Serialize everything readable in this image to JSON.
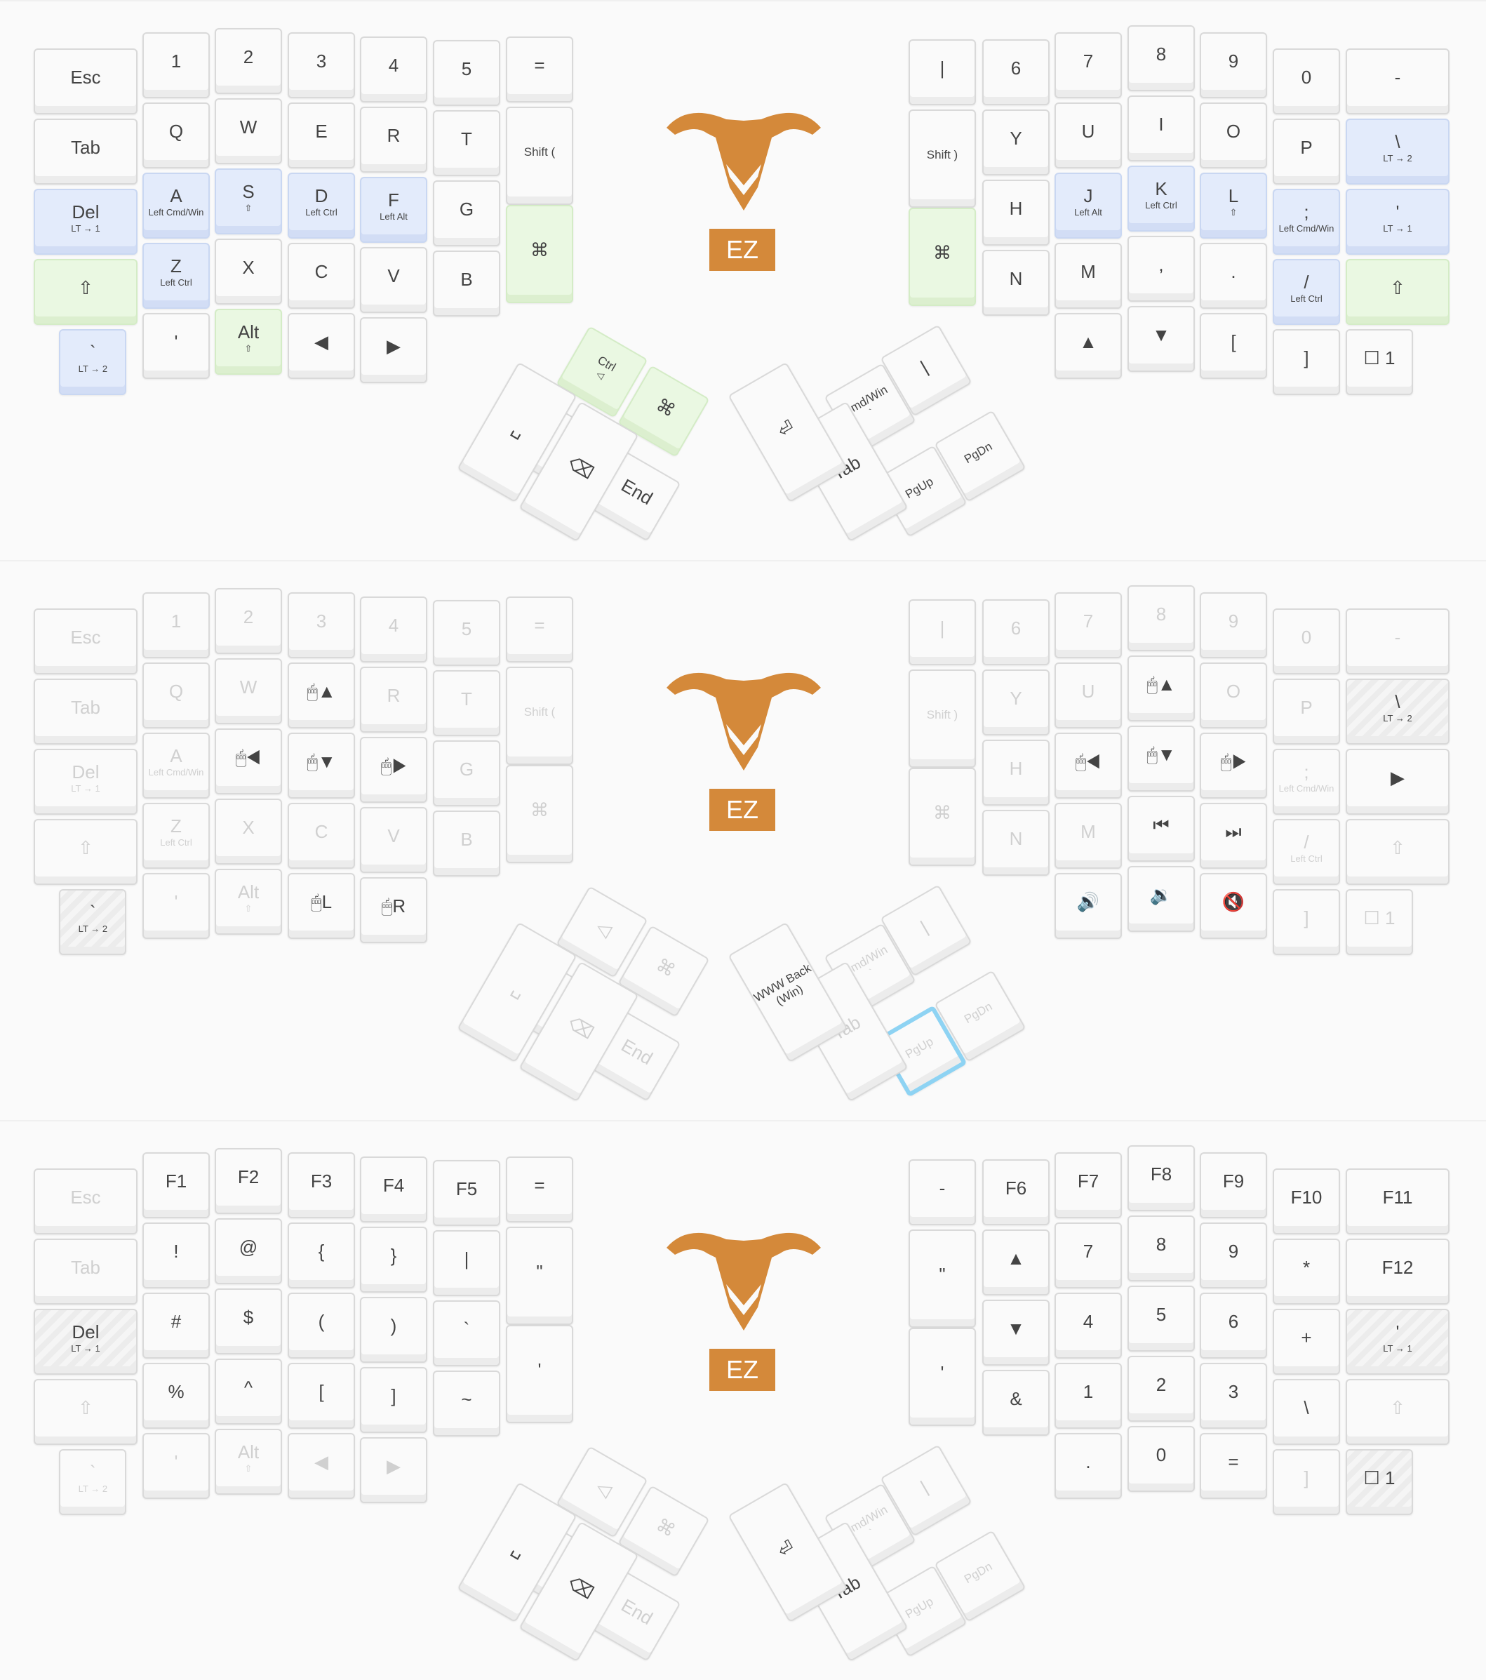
{
  "brand": {
    "logo_text": "EZ",
    "accent": "#d4893a"
  },
  "colors": {
    "modifier_blue": "#e3ebfb",
    "modifier_green": "#eaf8e2",
    "selection": "#8ed3f3"
  },
  "layers": [
    {
      "name": "layer-0",
      "dim": false,
      "left": [
        [
          {
            "m": "Esc"
          },
          {
            "m": "1"
          },
          {
            "m": "2"
          },
          {
            "m": "3"
          },
          {
            "m": "4"
          },
          {
            "m": "5"
          },
          {
            "m": "="
          }
        ],
        [
          {
            "m": "Tab"
          },
          {
            "m": "Q"
          },
          {
            "m": "W"
          },
          {
            "m": "E"
          },
          {
            "m": "R"
          },
          {
            "m": "T"
          },
          {
            "m": "Shift ("
          }
        ],
        [
          {
            "m": "Del",
            "s": "LT → 1",
            "c": "blue"
          },
          {
            "m": "A",
            "s": "Left Cmd/Win",
            "c": "blue"
          },
          {
            "m": "S",
            "s": "⇧",
            "c": "blue"
          },
          {
            "m": "D",
            "s": "Left Ctrl",
            "c": "blue"
          },
          {
            "m": "F",
            "s": "Left Alt",
            "c": "blue"
          },
          {
            "m": "G"
          },
          {
            "m": "⌘",
            "c": "green"
          }
        ],
        [
          {
            "m": "⇧",
            "c": "green"
          },
          {
            "m": "Z",
            "s": "Left Ctrl",
            "c": "blue"
          },
          {
            "m": "X"
          },
          {
            "m": "C"
          },
          {
            "m": "V"
          },
          {
            "m": "B"
          }
        ],
        [
          {
            "m": "`",
            "s": "LT → 2",
            "c": "blue"
          },
          {
            "m": "'"
          },
          {
            "m": "Alt",
            "s": "⇧",
            "c": "green"
          },
          {
            "m": "◀"
          },
          {
            "m": "▶"
          }
        ]
      ],
      "right": [
        [
          {
            "m": "|"
          },
          {
            "m": "6"
          },
          {
            "m": "7"
          },
          {
            "m": "8"
          },
          {
            "m": "9"
          },
          {
            "m": "0"
          },
          {
            "m": "-"
          }
        ],
        [
          {
            "m": "Shift )"
          },
          {
            "m": "Y"
          },
          {
            "m": "U"
          },
          {
            "m": "I"
          },
          {
            "m": "O"
          },
          {
            "m": "P"
          },
          {
            "m": "\\",
            "s": "LT → 2",
            "c": "blue"
          }
        ],
        [
          {
            "m": "H"
          },
          {
            "m": "J",
            "s": "Left Alt",
            "c": "blue"
          },
          {
            "m": "K",
            "s": "Left Ctrl",
            "c": "blue"
          },
          {
            "m": "L",
            "s": "⇧",
            "c": "blue"
          },
          {
            "m": ";",
            "s": "Left Cmd/Win",
            "c": "blue"
          },
          {
            "m": "'",
            "s": "LT → 1",
            "c": "blue"
          }
        ],
        [
          {
            "m": "⌘",
            "c": "green"
          },
          {
            "m": "N"
          },
          {
            "m": "M"
          },
          {
            "m": ","
          },
          {
            "m": "."
          },
          {
            "m": "/",
            "s": "Left Ctrl",
            "c": "blue"
          },
          {
            "m": "⇧",
            "c": "green"
          }
        ],
        [
          {
            "m": "▲"
          },
          {
            "m": "▼"
          },
          {
            "m": "["
          },
          {
            "m": "]"
          },
          {
            "m": "☐ 1"
          }
        ]
      ],
      "thumb_left": [
        {
          "m": "Ctrl",
          "s": "◁",
          "c": "green"
        },
        {
          "m": "⌘",
          "c": "green"
        },
        {
          "m": "Home"
        },
        {
          "m": "End"
        },
        {
          "m": "␣"
        },
        {
          "m": "⌫"
        }
      ],
      "thumb_right": [
        {
          "m": "Cmd/Win",
          "s": "`"
        },
        {
          "m": "|"
        },
        {
          "m": "PgUp"
        },
        {
          "m": "PgDn"
        },
        {
          "m": "Tab"
        },
        {
          "m": "⏎"
        }
      ]
    },
    {
      "name": "layer-1",
      "dim": true,
      "left": [
        [
          {
            "m": "Esc",
            "t": 1
          },
          {
            "m": "1",
            "t": 1
          },
          {
            "m": "2",
            "t": 1
          },
          {
            "m": "3",
            "t": 1
          },
          {
            "m": "4",
            "t": 1
          },
          {
            "m": "5",
            "t": 1
          },
          {
            "m": "=",
            "t": 1
          }
        ],
        [
          {
            "m": "Tab",
            "t": 1
          },
          {
            "m": "Q",
            "t": 1
          },
          {
            "m": "W",
            "t": 1
          },
          {
            "m": "🖱▲"
          },
          {
            "m": "R",
            "t": 1
          },
          {
            "m": "T",
            "t": 1
          },
          {
            "m": "Shift (",
            "t": 1
          }
        ],
        [
          {
            "m": "Del",
            "s": "LT → 1",
            "t": 1
          },
          {
            "m": "A",
            "s": "Left Cmd/Win",
            "t": 1
          },
          {
            "m": "🖱◀"
          },
          {
            "m": "🖱▼"
          },
          {
            "m": "🖱▶"
          },
          {
            "m": "G",
            "t": 1
          },
          {
            "m": "⌘",
            "t": 1
          }
        ],
        [
          {
            "m": "⇧",
            "t": 1
          },
          {
            "m": "Z",
            "s": "Left Ctrl",
            "t": 1
          },
          {
            "m": "X",
            "t": 1
          },
          {
            "m": "C",
            "t": 1
          },
          {
            "m": "V",
            "t": 1
          },
          {
            "m": "B",
            "t": 1
          }
        ],
        [
          {
            "m": "`",
            "s": "LT → 2",
            "c": "hatch"
          },
          {
            "m": "'",
            "t": 1
          },
          {
            "m": "Alt",
            "s": "⇧",
            "t": 1
          },
          {
            "m": "🖱L"
          },
          {
            "m": "🖱R"
          }
        ]
      ],
      "right": [
        [
          {
            "m": "|",
            "t": 1
          },
          {
            "m": "6",
            "t": 1
          },
          {
            "m": "7",
            "t": 1
          },
          {
            "m": "8",
            "t": 1
          },
          {
            "m": "9",
            "t": 1
          },
          {
            "m": "0",
            "t": 1
          },
          {
            "m": "-",
            "t": 1
          }
        ],
        [
          {
            "m": "Shift )",
            "t": 1
          },
          {
            "m": "Y",
            "t": 1
          },
          {
            "m": "U",
            "t": 1
          },
          {
            "m": "🖱▲"
          },
          {
            "m": "O",
            "t": 1
          },
          {
            "m": "P",
            "t": 1
          },
          {
            "m": "\\",
            "s": "LT → 2",
            "c": "hatch"
          }
        ],
        [
          {
            "m": "H",
            "t": 1
          },
          {
            "m": "🖱◀"
          },
          {
            "m": "🖱▼"
          },
          {
            "m": "🖱▶"
          },
          {
            "m": ";",
            "s": "Left Cmd/Win",
            "t": 1
          },
          {
            "m": "▶"
          }
        ],
        [
          {
            "m": "⌘",
            "t": 1
          },
          {
            "m": "N",
            "t": 1
          },
          {
            "m": "M",
            "t": 1
          },
          {
            "m": "⏮"
          },
          {
            "m": "⏭"
          },
          {
            "m": "/",
            "s": "Left Ctrl",
            "t": 1
          },
          {
            "m": "⇧",
            "t": 1
          }
        ],
        [
          {
            "m": "🔊"
          },
          {
            "m": "🔉"
          },
          {
            "m": "🔇"
          },
          {
            "m": "]",
            "t": 1
          },
          {
            "m": "☐ 1",
            "t": 1
          }
        ]
      ],
      "thumb_left": [
        {
          "m": "◁",
          "t": 1
        },
        {
          "m": "⌘",
          "t": 1
        },
        {
          "m": "Home",
          "t": 1
        },
        {
          "m": "End",
          "t": 1
        },
        {
          "m": "␣",
          "t": 1
        },
        {
          "m": "⌫",
          "t": 1
        }
      ],
      "thumb_right": [
        {
          "m": "Cmd/Win",
          "s": "`",
          "t": 1
        },
        {
          "m": "|",
          "t": 1
        },
        {
          "m": "PgUp",
          "t": 1,
          "sel": 1
        },
        {
          "m": "PgDn",
          "t": 1
        },
        {
          "m": "Tab",
          "t": 1
        },
        {
          "m": "WWW Back (Win)"
        }
      ]
    },
    {
      "name": "layer-2",
      "dim": true,
      "left": [
        [
          {
            "m": "Esc",
            "t": 1
          },
          {
            "m": "F1"
          },
          {
            "m": "F2"
          },
          {
            "m": "F3"
          },
          {
            "m": "F4"
          },
          {
            "m": "F5"
          },
          {
            "m": "="
          }
        ],
        [
          {
            "m": "Tab",
            "t": 1
          },
          {
            "m": "!"
          },
          {
            "m": "@"
          },
          {
            "m": "{"
          },
          {
            "m": "}"
          },
          {
            "m": "|"
          },
          {
            "m": "\""
          }
        ],
        [
          {
            "m": "Del",
            "s": "LT → 1",
            "c": "hatch"
          },
          {
            "m": "#"
          },
          {
            "m": "$"
          },
          {
            "m": "("
          },
          {
            "m": ")"
          },
          {
            "m": "`"
          },
          {
            "m": "'"
          }
        ],
        [
          {
            "m": "⇧",
            "t": 1
          },
          {
            "m": "%"
          },
          {
            "m": "^"
          },
          {
            "m": "["
          },
          {
            "m": "]"
          },
          {
            "m": "~"
          }
        ],
        [
          {
            "m": "`",
            "s": "LT → 2",
            "t": 1
          },
          {
            "m": "'",
            "t": 1
          },
          {
            "m": "Alt",
            "s": "⇧",
            "t": 1
          },
          {
            "m": "◀",
            "t": 1
          },
          {
            "m": "▶",
            "t": 1
          }
        ]
      ],
      "right": [
        [
          {
            "m": "-"
          },
          {
            "m": "F6"
          },
          {
            "m": "F7"
          },
          {
            "m": "F8"
          },
          {
            "m": "F9"
          },
          {
            "m": "F10"
          },
          {
            "m": "F11"
          }
        ],
        [
          {
            "m": "\""
          },
          {
            "m": "▲"
          },
          {
            "m": "7"
          },
          {
            "m": "8"
          },
          {
            "m": "9"
          },
          {
            "m": "*"
          },
          {
            "m": "F12"
          }
        ],
        [
          {
            "m": "▼"
          },
          {
            "m": "4"
          },
          {
            "m": "5"
          },
          {
            "m": "6"
          },
          {
            "m": "+"
          },
          {
            "m": "'",
            "s": "LT → 1",
            "c": "hatch"
          }
        ],
        [
          {
            "m": "'"
          },
          {
            "m": "&"
          },
          {
            "m": "1"
          },
          {
            "m": "2"
          },
          {
            "m": "3"
          },
          {
            "m": "\\"
          },
          {
            "m": "⇧",
            "t": 1
          }
        ],
        [
          {
            "m": "."
          },
          {
            "m": "0"
          },
          {
            "m": "="
          },
          {
            "m": "]",
            "t": 1
          },
          {
            "m": "☐ 1",
            "c": "hatch"
          }
        ]
      ],
      "thumb_left": [
        {
          "m": "◁",
          "t": 1
        },
        {
          "m": "⌘",
          "t": 1
        },
        {
          "m": "Home",
          "t": 1
        },
        {
          "m": "End",
          "t": 1
        },
        {
          "m": "␣"
        },
        {
          "m": "⌫"
        }
      ],
      "thumb_right": [
        {
          "m": "Cmd/Win",
          "s": "`",
          "t": 1
        },
        {
          "m": "|",
          "t": 1
        },
        {
          "m": "PgUp",
          "t": 1
        },
        {
          "m": "PgDn",
          "t": 1
        },
        {
          "m": "Tab"
        },
        {
          "m": "⏎"
        }
      ]
    }
  ]
}
